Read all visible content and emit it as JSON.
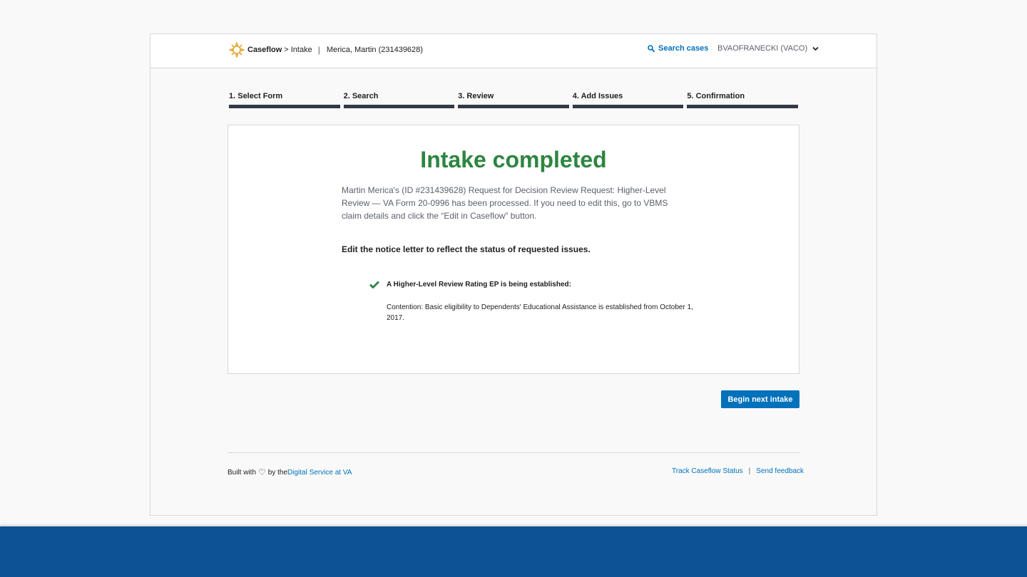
{
  "header": {
    "brand_name": "Caseflow",
    "brand_separator": ">",
    "app_name": "Intake",
    "pipe": "|",
    "veteran": "Merica, Martin (231439628)",
    "search_label": "Search cases",
    "user_label": "BVAOFRANECKI (VACO)"
  },
  "steps": [
    {
      "label": "1. Select Form"
    },
    {
      "label": "2. Search"
    },
    {
      "label": "3. Review"
    },
    {
      "label": "4. Add Issues"
    },
    {
      "label": "5. Confirmation"
    }
  ],
  "card": {
    "title": "Intake completed",
    "body": "Martin Merica's (ID #231439628) Request for Decision Review Request: Higher-Level Review — VA Form 20-0996 has been processed. If you need to edit this, go to VBMS claim details and click the “Edit in Caseflow” button.",
    "instruction": "Edit the notice letter to reflect the status of requested issues.",
    "issue_heading": "A Higher-Level Review Rating EP is being established:",
    "issue_detail": "Contention: Basic eligibility to Dependents' Educational Assistance is established from October 1, 2017."
  },
  "actions": {
    "next_label": "Begin next intake"
  },
  "footer": {
    "built_prefix": "Built with",
    "built_by": "by the",
    "built_link": "Digital Service at VA",
    "track_link": "Track Caseflow Status",
    "pipe": "|",
    "feedback_link": "Send feedback"
  },
  "colors": {
    "success_green": "#2e8540",
    "link_blue": "#0071bb",
    "step_bar": "#323a45",
    "bottom_band": "#0b5394"
  },
  "icons": {
    "logo": "caseflow-logo-icon",
    "search": "search-icon",
    "dropdown": "chevron-down-icon",
    "check": "checkmark-icon",
    "heart": "heart-icon"
  }
}
